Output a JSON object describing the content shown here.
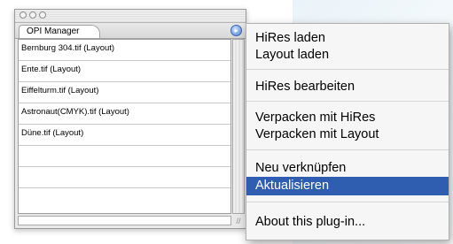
{
  "palette": {
    "tab_label": "OPI Manager",
    "menu_arrow_glyph": "▸",
    "rows": [
      "Bernburg 304.tif (Layout)",
      "Ente.tif (Layout)",
      "Eiffelturm.tif (Layout)",
      "Astronaut(CMYK).tif (Layout)",
      "Düne.tif (Layout)"
    ],
    "resize_grip_glyph": "//"
  },
  "menu": {
    "items": [
      {
        "label": "HiRes laden"
      },
      {
        "label": "Layout laden"
      },
      {
        "label": "HiRes bearbeiten"
      },
      {
        "label": "Verpacken mit HiRes"
      },
      {
        "label": "Verpacken mit Layout"
      },
      {
        "label": "Neu verknüpfen"
      },
      {
        "label": "Aktualisieren",
        "selected": true
      },
      {
        "label": "About this plug-in..."
      }
    ],
    "selected_color": "#2f5eb0"
  },
  "icons": {
    "menu_arrow": "menu-arrow-icon",
    "close": "close-icon",
    "minimize": "minimize-icon",
    "zoom": "zoom-icon",
    "resize_grip": "resize-grip-icon"
  }
}
